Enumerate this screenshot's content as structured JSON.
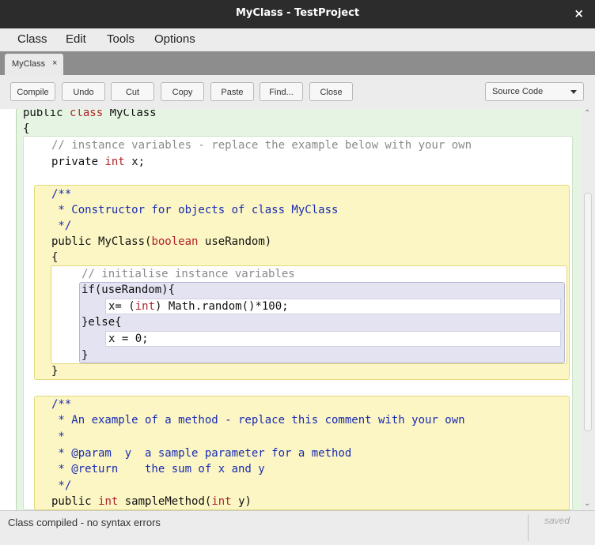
{
  "window": {
    "title": "MyClass - TestProject",
    "close_glyph": "×"
  },
  "menu": [
    "Class",
    "Edit",
    "Tools",
    "Options"
  ],
  "tab": {
    "label": "MyClass",
    "close_glyph": "×"
  },
  "toolbar": {
    "buttons": [
      "Compile",
      "Undo",
      "Cut",
      "Copy",
      "Paste",
      "Find...",
      "Close"
    ],
    "view_select": "Source Code"
  },
  "code": {
    "l1": {
      "kw1": "public",
      "kw2": "class",
      "name": "MyClass"
    },
    "l2": "{",
    "l3": "// instance variables - replace the example below with your own",
    "l4": {
      "kw1": "private",
      "kw2": "int",
      "rest": "x;"
    },
    "l5": "/**",
    "l6": " * Constructor for objects of class MyClass",
    "l7": " */",
    "l8": {
      "kw1": "public",
      "mid": "MyClass(",
      "kw2": "boolean",
      "rest": "useRandom)"
    },
    "l9": "{",
    "l10": "// initialise instance variables",
    "l11": "if(useRandom){",
    "l12": {
      "a": "x= (",
      "kw": "int",
      "b": ") Math.random()*100;"
    },
    "l13": "}else{",
    "l14": "x = 0;",
    "l15": "}",
    "l16": "}",
    "l17": "/**",
    "l18": " * An example of a method - replace this comment with your own",
    "l19": " *",
    "l20": " * @param  y  a sample parameter for a method",
    "l21": " * @return    the sum of x and y",
    "l22": " */",
    "l23": {
      "kw1": "public",
      "kw2": "int",
      "mid": "sampleMethod(",
      "kw3": "int",
      "rest": "y)"
    }
  },
  "status": {
    "message": "Class compiled - no syntax errors",
    "saved": "saved"
  },
  "colors": {
    "class_scope": "#e6f5e3",
    "method_scope": "#fbf6c4",
    "if_scope": "#e3e3f1",
    "keyword": "#b0232a",
    "javadoc": "#1a2bb0",
    "comment": "#8a8a8a"
  }
}
